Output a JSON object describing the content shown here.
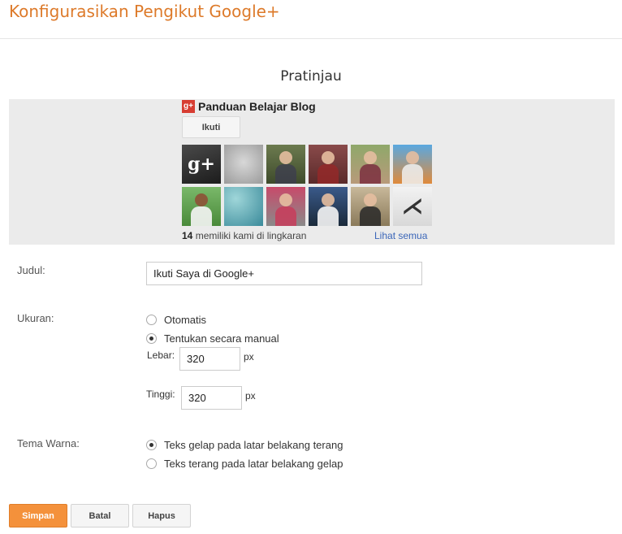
{
  "header": {
    "title": "Konfigurasikan Pengikut Google+"
  },
  "preview": {
    "heading": "Pratinjau",
    "widget": {
      "logo_text": "g+",
      "page_name": "Panduan Belajar Blog",
      "follow_label": "Ikuti",
      "count": "14",
      "count_suffix": "memiliki kami di lingkaran",
      "see_all": "Lihat semua",
      "avatar_icons": [
        "google-plus-logo-avatar",
        "statue-face-avatar",
        "group-photo-avatar",
        "group-photo-avatar",
        "person-photo-avatar",
        "person-photo-avatar",
        "person-photo-avatar",
        "water-drops-avatar",
        "person-photo-avatar",
        "person-photo-avatar",
        "person-photo-avatar",
        "bird-avatar"
      ]
    }
  },
  "form": {
    "title_label": "Judul:",
    "title_value": "Ikuti Saya di Google+",
    "size_label": "Ukuran:",
    "size_auto": "Otomatis",
    "size_manual": "Tentukan secara manual",
    "size_selected": "manual",
    "width_label": "Lebar:",
    "width_value": "320",
    "width_unit": "px",
    "height_label": "Tinggi:",
    "height_value": "320",
    "height_unit": "px",
    "theme_label": "Tema Warna:",
    "theme_dark": "Teks gelap pada latar belakang terang",
    "theme_light": "Teks terang pada latar belakang gelap",
    "theme_selected": "dark"
  },
  "buttons": {
    "save": "Simpan",
    "cancel": "Batal",
    "delete": "Hapus"
  },
  "colors": {
    "accent": "#dd7a2a",
    "primary_button": "#f4913b",
    "link": "#3b66b8",
    "gplus_red": "#d73d32"
  }
}
